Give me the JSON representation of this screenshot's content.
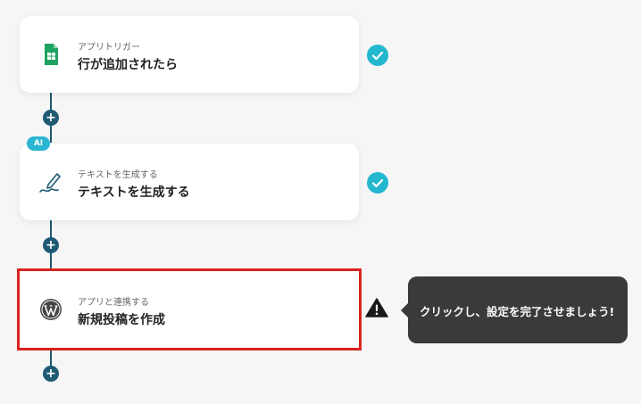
{
  "flow": {
    "steps": [
      {
        "sub_label": "アプリトリガー",
        "title": "行が追加されたら",
        "icon": "google-sheets-icon",
        "status": "complete"
      },
      {
        "badge": "AI",
        "sub_label": "テキストを生成する",
        "title": "テキストを生成する",
        "icon": "pen-writing-icon",
        "status": "complete"
      },
      {
        "sub_label": "アプリと連携する",
        "title": "新規投稿を作成",
        "icon": "wordpress-icon",
        "status": "warning",
        "highlighted": true
      }
    ],
    "add_button_symbol": "+"
  },
  "tooltip": {
    "text": "クリックし、設定を完了させましょう!"
  },
  "colors": {
    "connector": "#1e5a73",
    "check": "#23b8cf",
    "highlight_border": "#d9231d",
    "tooltip_bg": "#3a3a3a",
    "ai_badge": "#2bb6d3"
  }
}
